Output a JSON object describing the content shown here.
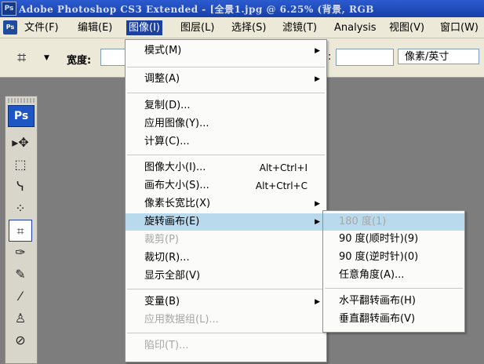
{
  "titlebar": {
    "badge": "Ps",
    "text": "Adobe Photoshop CS3 Extended - [全景1.jpg @ 6.25% (背景, RGB"
  },
  "menubar": {
    "app_icon": "Ps",
    "items": [
      {
        "label": "文件(F)"
      },
      {
        "label": "编辑(E)"
      },
      {
        "label": "图像(I)"
      },
      {
        "label": "图层(L)"
      },
      {
        "label": "选择(S)"
      },
      {
        "label": "滤镜(T)"
      },
      {
        "label": "Analysis"
      },
      {
        "label": "视图(V)"
      },
      {
        "label": "窗口(W)"
      }
    ]
  },
  "options": {
    "width_label": "宽度:",
    "res_colon": ":",
    "unit_select": "像素/英寸"
  },
  "toolbox": {
    "logo": "Ps",
    "tools": [
      {
        "icon": "▸✥"
      },
      {
        "icon": "⬚"
      },
      {
        "icon": "ᓭ"
      },
      {
        "icon": "⁘"
      },
      {
        "icon": "⌗"
      },
      {
        "icon": "✑"
      },
      {
        "icon": "✎"
      },
      {
        "icon": "⁄"
      },
      {
        "icon": "♙"
      },
      {
        "icon": "⊘"
      }
    ]
  },
  "image_menu": {
    "items": [
      {
        "label": "模式(M)",
        "shortcut": "",
        "submenu": true,
        "disabled": false
      },
      {
        "label": "调整(A)",
        "shortcut": "",
        "submenu": true,
        "disabled": false
      },
      {
        "label": "复制(D)...",
        "shortcut": "",
        "submenu": false,
        "disabled": false
      },
      {
        "label": "应用图像(Y)...",
        "shortcut": "",
        "submenu": false,
        "disabled": false
      },
      {
        "label": "计算(C)...",
        "shortcut": "",
        "submenu": false,
        "disabled": false
      },
      {
        "label": "图像大小(I)...",
        "shortcut": "Alt+Ctrl+I",
        "submenu": false,
        "disabled": false
      },
      {
        "label": "画布大小(S)...",
        "shortcut": "Alt+Ctrl+C",
        "submenu": false,
        "disabled": false
      },
      {
        "label": "像素长宽比(X)",
        "shortcut": "",
        "submenu": true,
        "disabled": false
      },
      {
        "label": "旋转画布(E)",
        "shortcut": "",
        "submenu": true,
        "disabled": false
      },
      {
        "label": "裁剪(P)",
        "shortcut": "",
        "submenu": false,
        "disabled": true
      },
      {
        "label": "裁切(R)...",
        "shortcut": "",
        "submenu": false,
        "disabled": false
      },
      {
        "label": "显示全部(V)",
        "shortcut": "",
        "submenu": false,
        "disabled": false
      },
      {
        "label": "变量(B)",
        "shortcut": "",
        "submenu": true,
        "disabled": false
      },
      {
        "label": "应用数据组(L)...",
        "shortcut": "",
        "submenu": false,
        "disabled": true
      },
      {
        "label": "陷印(T)...",
        "shortcut": "",
        "submenu": false,
        "disabled": true
      }
    ]
  },
  "rotate_submenu": {
    "items": [
      {
        "label": "180 度(1)",
        "disabled": true
      },
      {
        "label": "90 度(顺时针)(9)",
        "disabled": false
      },
      {
        "label": "90 度(逆时针)(0)",
        "disabled": false
      },
      {
        "label": "任意角度(A)...",
        "disabled": false
      },
      {
        "label": "水平翻转画布(H)",
        "disabled": false
      },
      {
        "label": "垂直翻转画布(V)",
        "disabled": false
      }
    ]
  }
}
